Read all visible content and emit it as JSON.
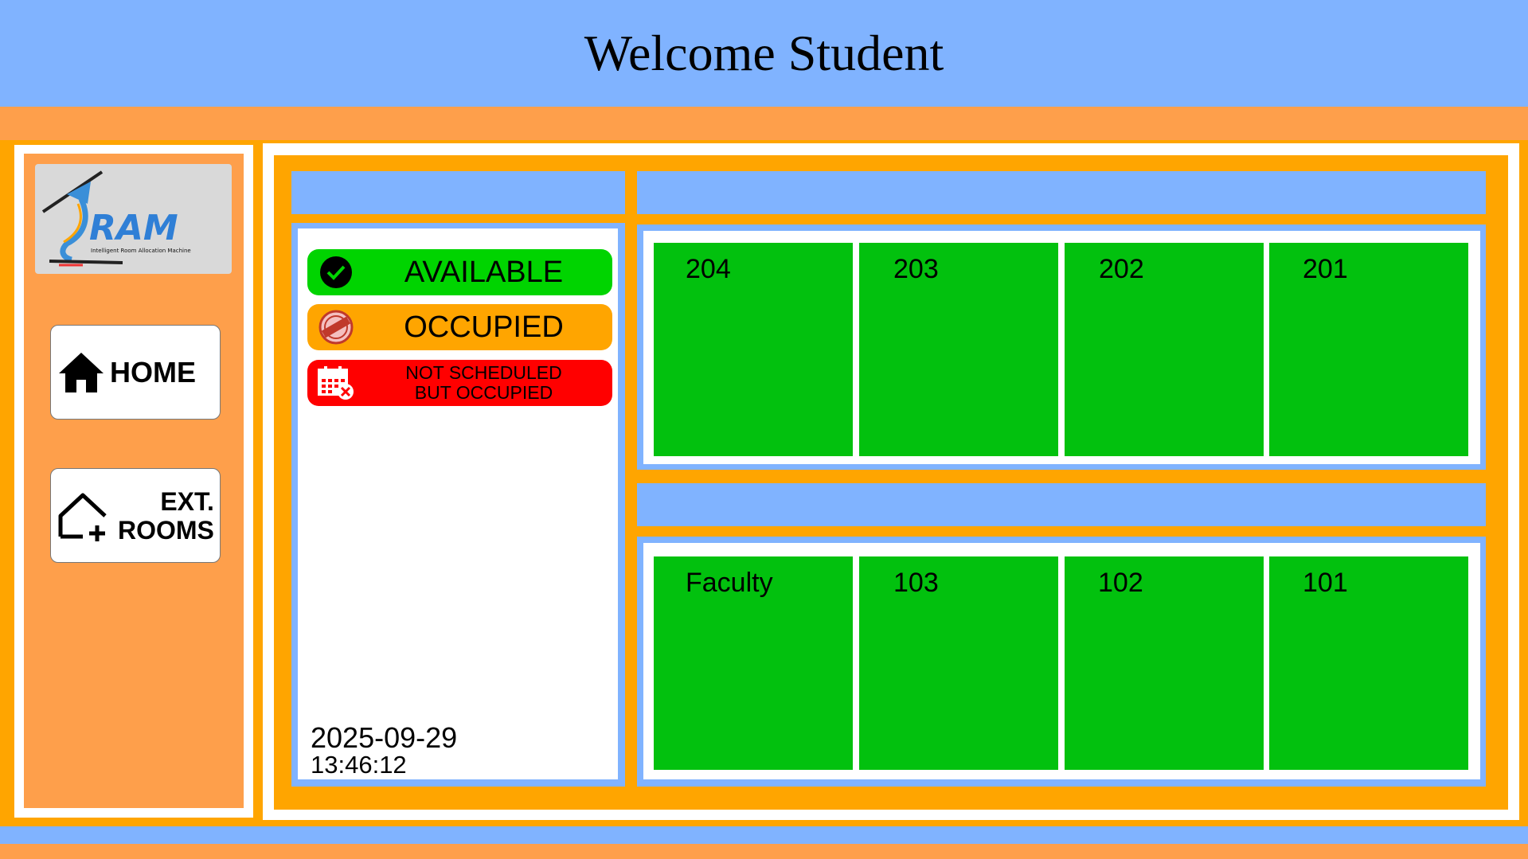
{
  "header": {
    "title": "Welcome Student"
  },
  "sidebar": {
    "logo": {
      "text": "RAM",
      "tagline": "Intelligent Room Allocation Machine"
    },
    "home_label": "HOME",
    "ext_rooms_line1": "EXT.",
    "ext_rooms_line2": "ROOMS"
  },
  "legend": {
    "available": "AVAILABLE",
    "occupied": "OCCUPIED",
    "not_scheduled_line1": "NOT SCHEDULED",
    "not_scheduled_line2": "BUT OCCUPIED",
    "icons": [
      "check-circle-icon",
      "occupied-stamp-icon",
      "calendar-x-icon"
    ]
  },
  "datetime": {
    "date": "2025-09-29",
    "time": "13:46:12"
  },
  "floors": [
    {
      "rooms": [
        "204",
        "203",
        "202",
        "201"
      ]
    },
    {
      "rooms": [
        "Faculty",
        "103",
        "102",
        "101"
      ]
    }
  ],
  "colors": {
    "header_blue": "#80b3ff",
    "orange": "#ffa500",
    "light_orange": "#fe9f4b",
    "available_green": "#02c10e",
    "legend_green": "#00d400",
    "not_scheduled_red": "#ff0000"
  }
}
